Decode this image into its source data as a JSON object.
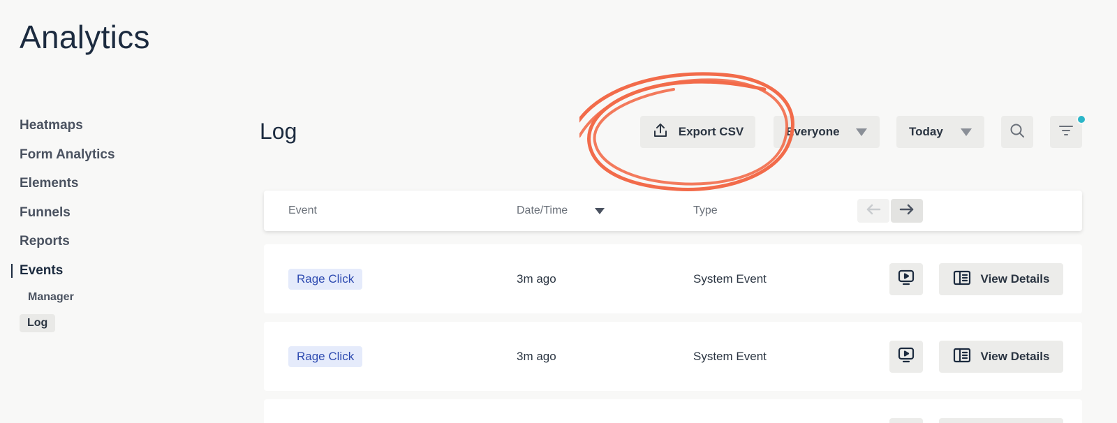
{
  "app": {
    "title": "Analytics"
  },
  "sidebar": {
    "items": [
      {
        "label": "Heatmaps"
      },
      {
        "label": "Form Analytics"
      },
      {
        "label": "Elements"
      },
      {
        "label": "Funnels"
      },
      {
        "label": "Reports"
      },
      {
        "label": "Events"
      }
    ],
    "sub_items": [
      {
        "label": "Manager"
      },
      {
        "label": "Log"
      }
    ]
  },
  "main": {
    "title": "Log",
    "toolbar": {
      "export_label": "Export CSV",
      "audience_value": "Everyone",
      "date_value": "Today"
    },
    "table": {
      "headers": {
        "event": "Event",
        "datetime": "Date/Time",
        "type": "Type"
      },
      "rows": [
        {
          "event": "Rage Click",
          "time": "3m ago",
          "type": "System Event",
          "details_label": "View Details"
        },
        {
          "event": "Rage Click",
          "time": "3m ago",
          "type": "System Event",
          "details_label": "View Details"
        }
      ]
    }
  },
  "colors": {
    "annotation": "#f26b4a",
    "tag_bg": "#e5ebfb",
    "tag_text": "#2d4ab0",
    "notification_dot": "#2bb6c8"
  },
  "icons": [
    "upload-icon",
    "caret-down-icon",
    "search-icon",
    "filter-icon",
    "arrow-left-icon",
    "arrow-right-icon",
    "play-icon",
    "details-icon"
  ]
}
